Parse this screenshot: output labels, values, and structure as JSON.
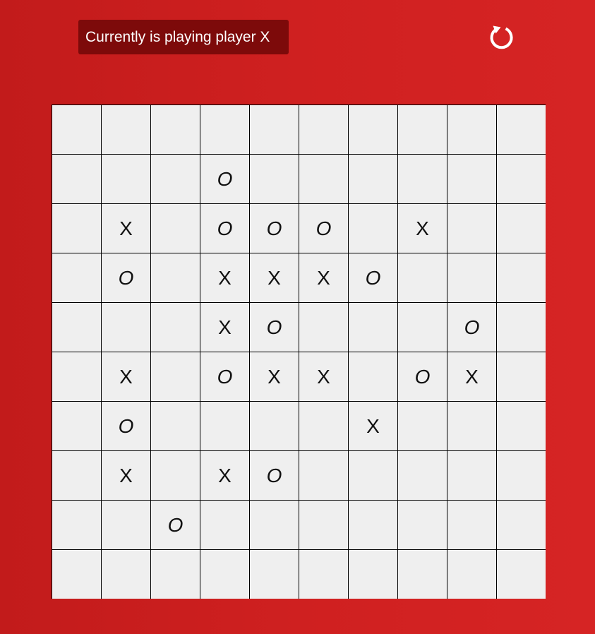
{
  "status_text": "Currently is playing player X",
  "reset_icon": "restart-icon",
  "colors": {
    "background": "#cf2020",
    "status_bg": "#7d0a0a",
    "cell_bg": "#efefef",
    "grid_line": "#000000"
  },
  "board": [
    [
      "",
      "",
      "",
      "",
      "",
      "",
      "",
      "",
      "",
      ""
    ],
    [
      "",
      "",
      "",
      "O",
      "",
      "",
      "",
      "",
      "",
      ""
    ],
    [
      "",
      "X",
      "",
      "O",
      "O",
      "O",
      "",
      "X",
      "",
      ""
    ],
    [
      "",
      "O",
      "",
      "X",
      "X",
      "X",
      "O",
      "",
      "",
      ""
    ],
    [
      "",
      "",
      "",
      "X",
      "O",
      "",
      "",
      "",
      "O",
      ""
    ],
    [
      "",
      "X",
      "",
      "O",
      "X",
      "X",
      "",
      "O",
      "X",
      ""
    ],
    [
      "",
      "O",
      "",
      "",
      "",
      "",
      "X",
      "",
      "",
      ""
    ],
    [
      "",
      "X",
      "",
      "X",
      "O",
      "",
      "",
      "",
      "",
      ""
    ],
    [
      "",
      "",
      "O",
      "",
      "",
      "",
      "",
      "",
      "",
      ""
    ],
    [
      "",
      "",
      "",
      "",
      "",
      "",
      "",
      "",
      "",
      ""
    ]
  ]
}
